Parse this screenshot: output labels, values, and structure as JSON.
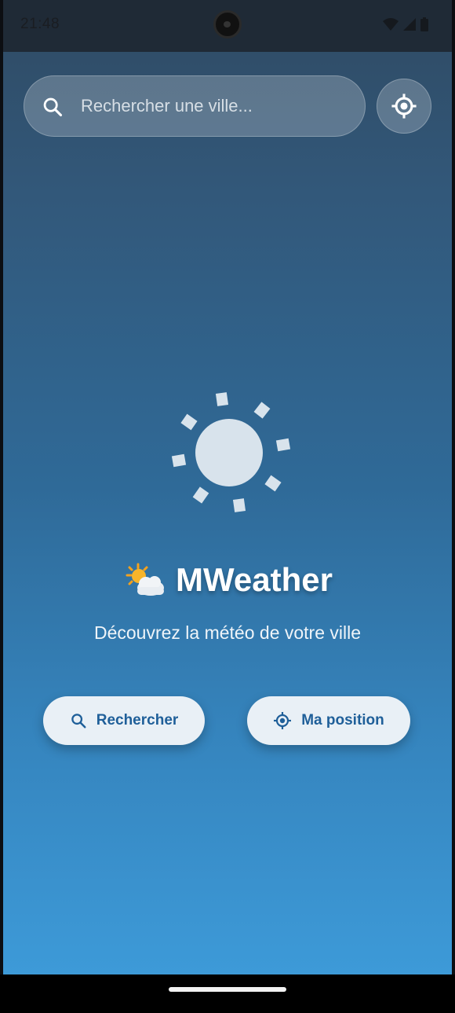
{
  "status_bar": {
    "time": "21:48",
    "icons": [
      "wifi-icon",
      "cell-signal-icon",
      "battery-icon"
    ]
  },
  "search": {
    "placeholder": "Rechercher une ville...",
    "value": "",
    "icon": "search-icon"
  },
  "locate_button": {
    "icon": "locate-icon"
  },
  "hero": {
    "icon": "sun-icon",
    "title_emoji": "sun-behind-cloud-icon",
    "title": "MWeather",
    "subtitle": "Découvrez la météo de votre ville"
  },
  "actions": {
    "search_label": "Rechercher",
    "position_label": "Ma position"
  },
  "colors": {
    "gradient_top": "#2f4a63",
    "gradient_bottom": "#3d9ad8",
    "button_bg": "#e9f0f6",
    "button_text": "#1f5f99"
  }
}
